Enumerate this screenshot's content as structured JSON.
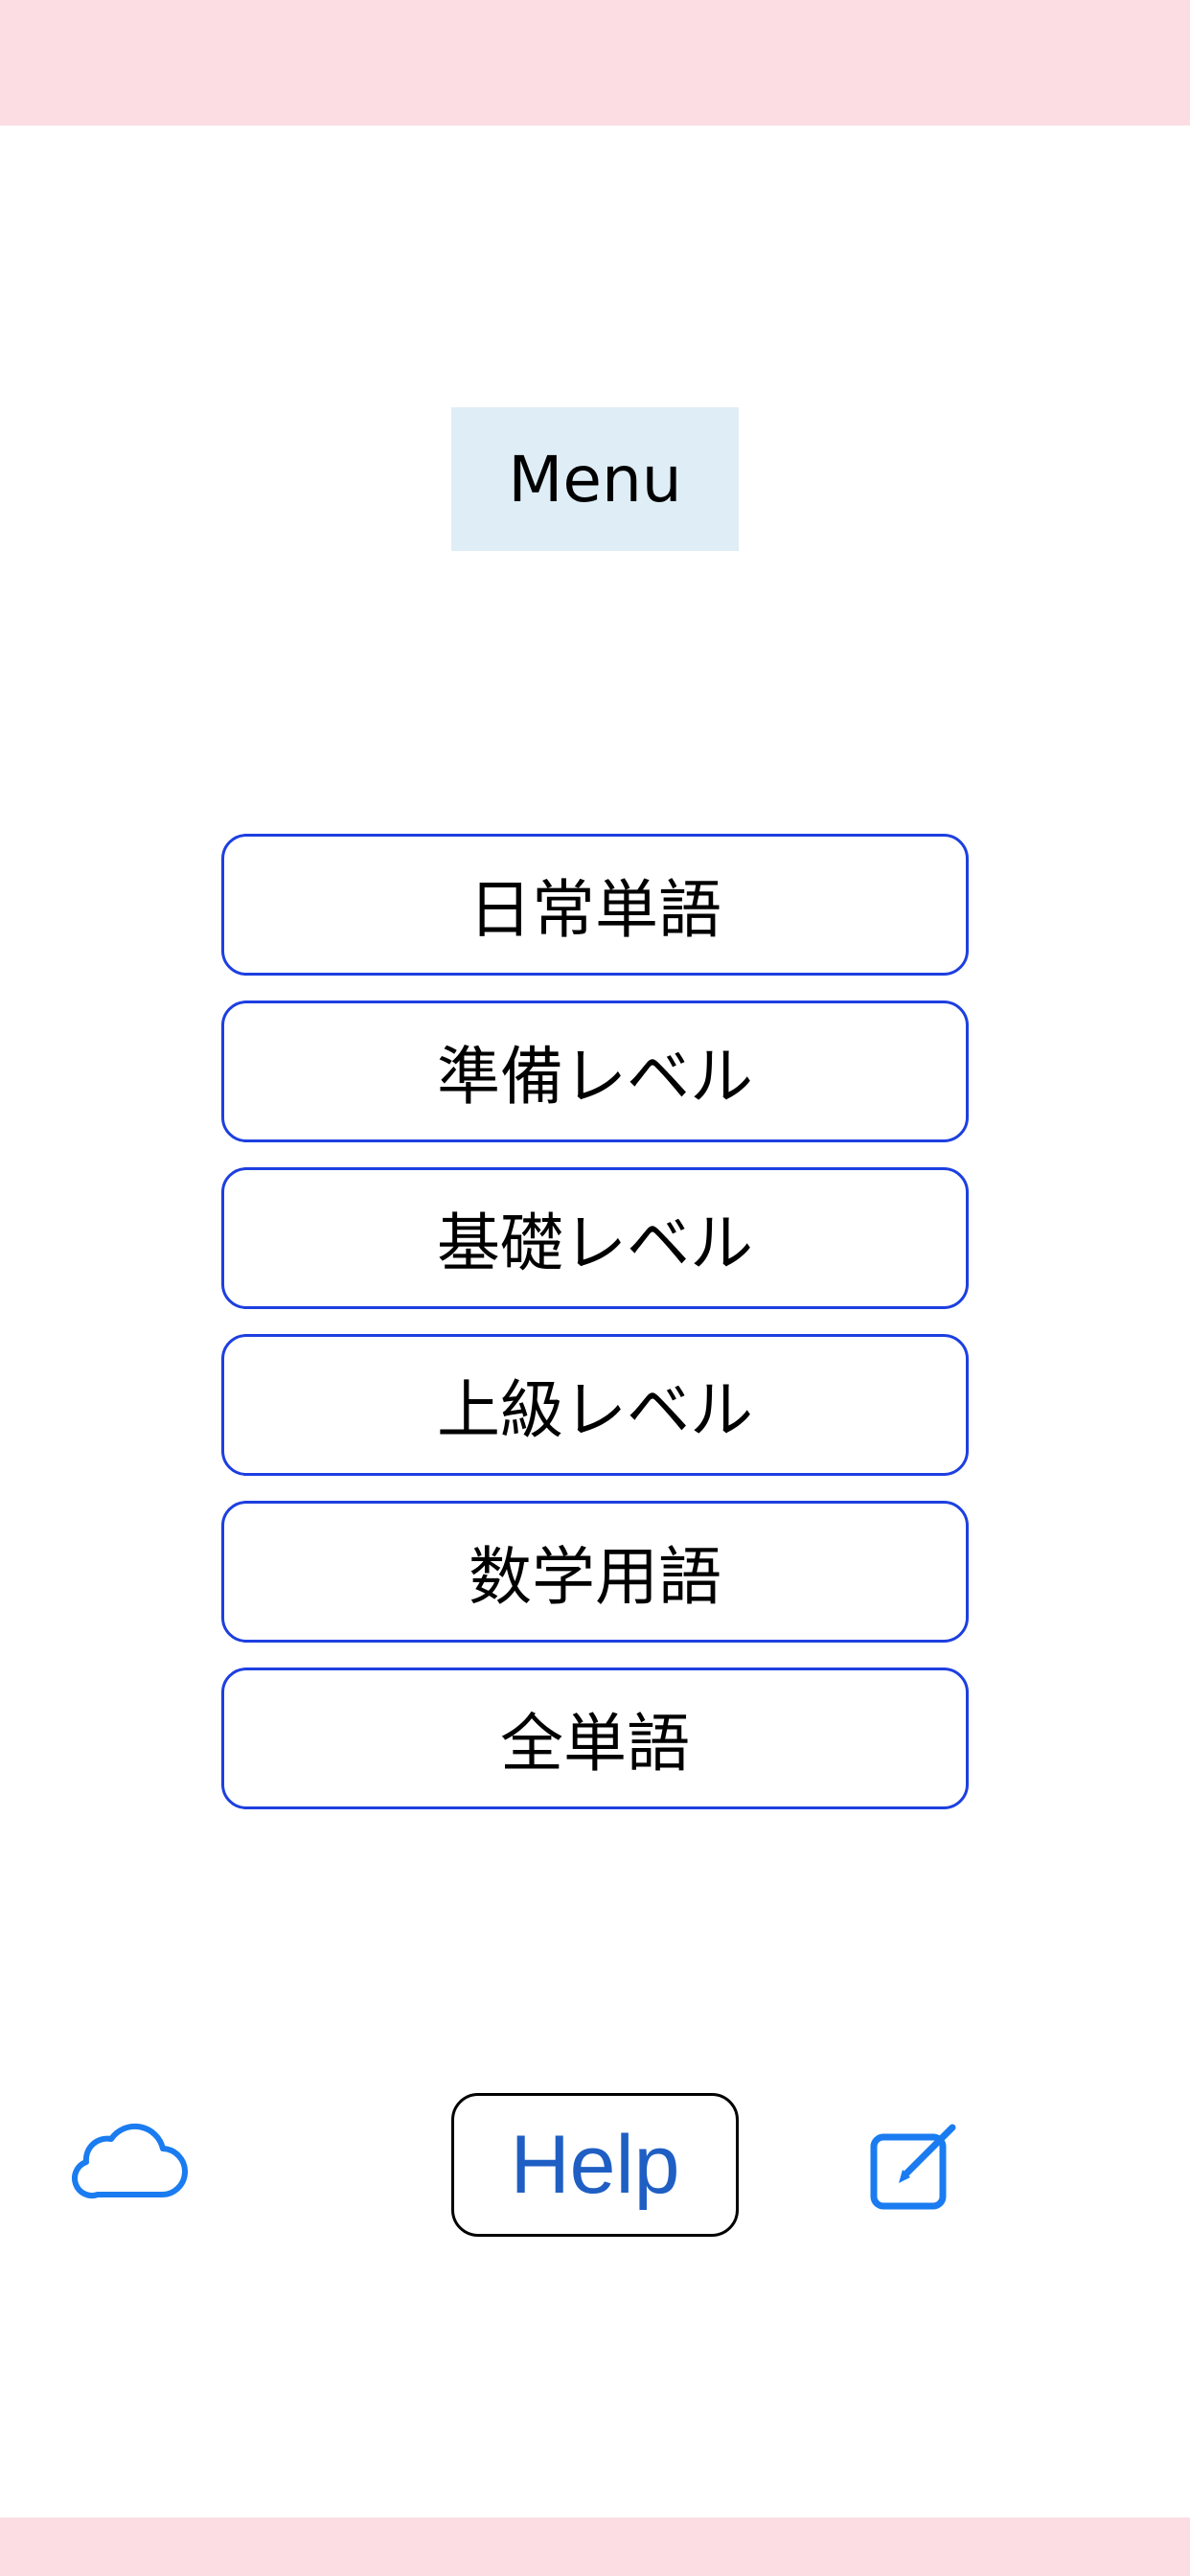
{
  "header": {
    "menu_title": "Menu"
  },
  "menu": {
    "items": [
      {
        "label": "日常単語"
      },
      {
        "label": "準備レベル"
      },
      {
        "label": "基礎レベル"
      },
      {
        "label": "上級レベル"
      },
      {
        "label": "数学用語"
      },
      {
        "label": "全単語"
      }
    ]
  },
  "toolbar": {
    "help_label": "Help",
    "cloud_icon": "cloud-icon",
    "edit_icon": "compose-icon"
  },
  "colors": {
    "top_bar": "#fbdde3",
    "bottom_bar": "#fbdde3",
    "title_bg": "#dfeef6",
    "button_border": "#1d3fe0",
    "icon_blue": "#1a7cf0",
    "help_text": "#1f5fc4"
  }
}
